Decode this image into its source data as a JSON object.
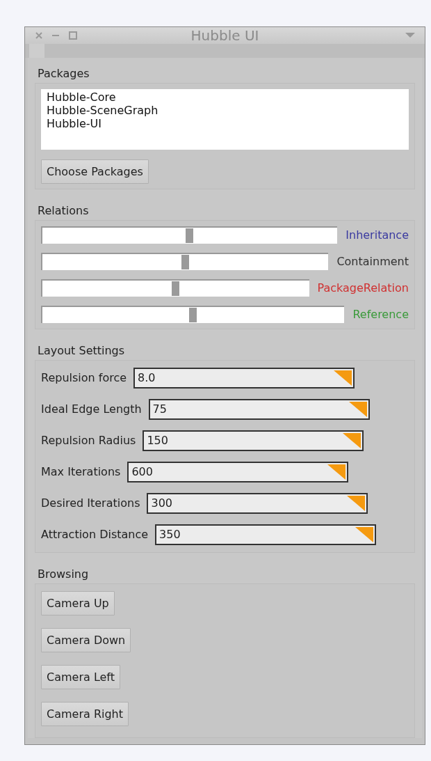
{
  "window": {
    "title": "Hubble UI"
  },
  "packages": {
    "title": "Packages",
    "items": [
      "Hubble-Core",
      "Hubble-SceneGraph",
      "Hubble-UI"
    ],
    "button": "Choose Packages"
  },
  "relations": {
    "title": "Relations",
    "sliders": [
      {
        "label": "Inheritance",
        "color": "#3a3aa0",
        "level": 0.5
      },
      {
        "label": "Containment",
        "color": "#333333",
        "level": 0.5
      },
      {
        "label": "PackageRelation",
        "color": "#d03030",
        "level": 0.5
      },
      {
        "label": "Reference",
        "color": "#3a9a3a",
        "level": 0.5
      }
    ]
  },
  "layout_settings": {
    "title": "Layout Settings",
    "fields": [
      {
        "label": "Repulsion force",
        "value": "8.0"
      },
      {
        "label": "Ideal Edge Length",
        "value": "75"
      },
      {
        "label": "Repulsion Radius",
        "value": "150"
      },
      {
        "label": "Max Iterations",
        "value": "600"
      },
      {
        "label": "Desired Iterations",
        "value": "300"
      },
      {
        "label": "Attraction Distance",
        "value": "350"
      }
    ]
  },
  "browsing": {
    "title": "Browsing",
    "buttons": [
      "Camera Up",
      "Camera Down",
      "Camera Left",
      "Camera Right"
    ]
  }
}
